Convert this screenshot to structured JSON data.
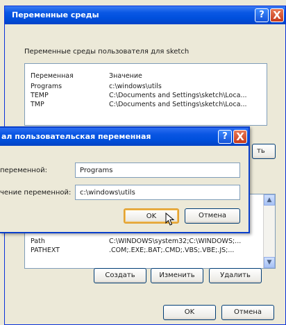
{
  "env_dialog": {
    "title": "Переменные среды",
    "help_label": "?",
    "close_label": "X",
    "user_section_label": "Переменные среды пользователя для sketch",
    "user_list": {
      "headers": [
        "Переменная",
        "Значение"
      ],
      "rows": [
        {
          "name": "Programs",
          "value": "c:\\windows\\utils"
        },
        {
          "name": "TEMP",
          "value": "C:\\Documents and Settings\\sketch\\Loca..."
        },
        {
          "name": "TMP",
          "value": "C:\\Documents and Settings\\sketch\\Loca..."
        }
      ]
    },
    "partial_button_label": "ть",
    "system_list": {
      "rows": [
        {
          "name": "Path",
          "value": "C:\\WINDOWS\\system32;C:\\WINDOWS;..."
        },
        {
          "name": "PATHEXT",
          "value": ".COM;.EXE;.BAT;.CMD;.VBS;.VBE;.JS;..."
        }
      ],
      "scroll_up": "▲",
      "scroll_down": "▼"
    },
    "system_buttons": {
      "create": "Создать",
      "edit": "Изменить",
      "delete": "Удалить"
    },
    "ok_label": "OK",
    "cancel_label": "Отмена"
  },
  "edit_dialog": {
    "title": "ал пользовательская переменная",
    "help_label": "?",
    "close_label": "X",
    "name_label": "переменной:",
    "name_value": "Programs",
    "value_label": "чение переменной:",
    "value_value": "c:\\windows\\utils",
    "ok_label": "OK",
    "cancel_label": "Отмена"
  }
}
